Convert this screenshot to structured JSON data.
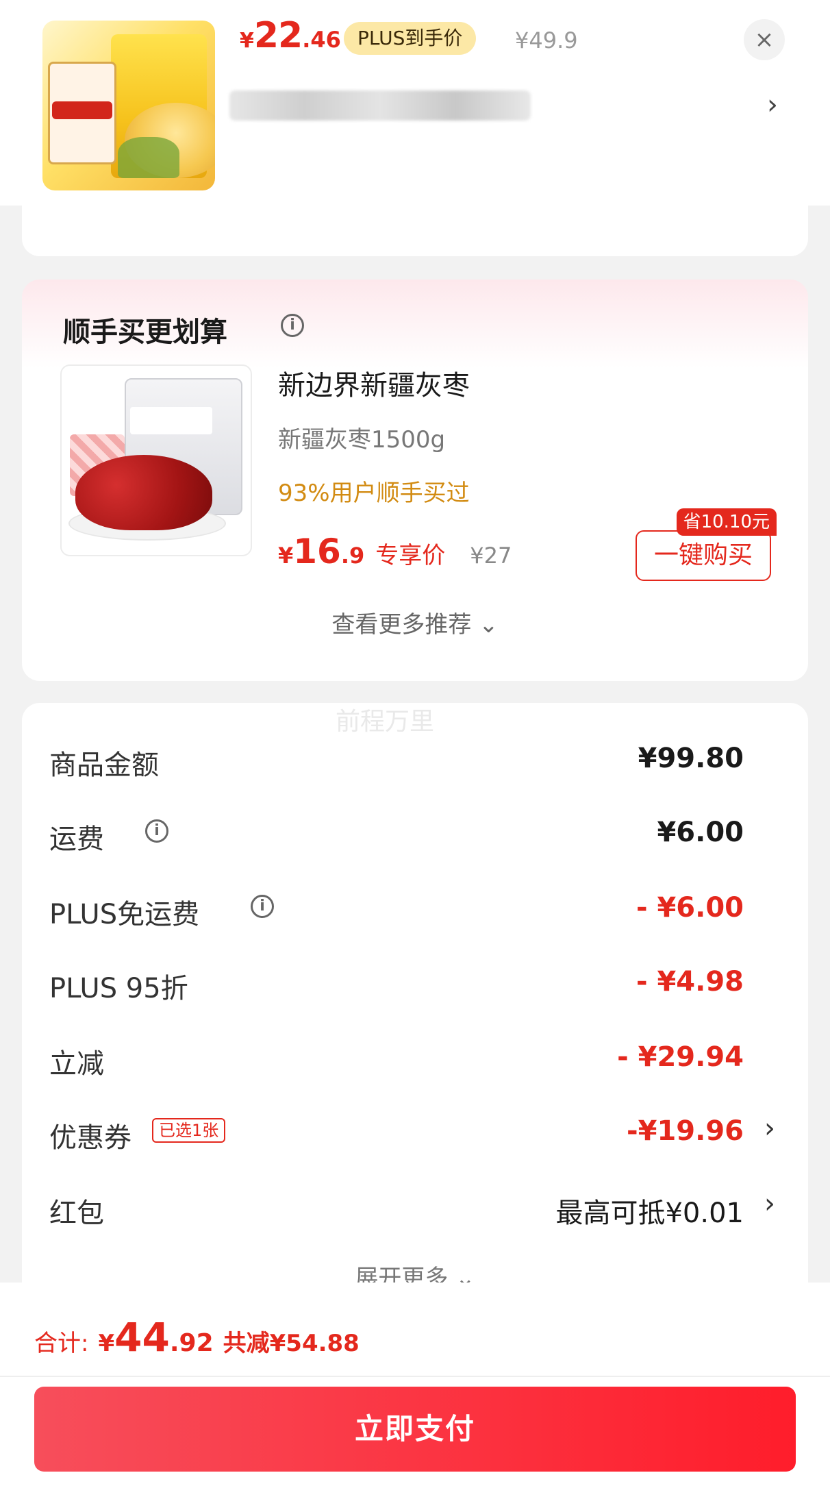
{
  "top_product": {
    "price_symbol": "¥",
    "price_int": "22",
    "price_dec": ".46",
    "plus_badge": "PLUS到手价",
    "old_price": "¥49.9",
    "close_glyph": "×",
    "chevron_glyph": "›"
  },
  "recommend": {
    "title": "顺手买更划算",
    "info_glyph": "i",
    "product_name": "新边界新疆灰枣",
    "spec": "新疆灰枣1500g",
    "social_proof": "93%用户顺手买过",
    "price_symbol": "¥",
    "price_int": "16",
    "price_dec": ".9",
    "price_label": "专享价",
    "old_price": "¥27",
    "save_badge": "省10.10元",
    "buy_button": "一键购买",
    "more_link": "查看更多推荐 ⌄"
  },
  "watermark": "前程万里",
  "fees": {
    "goods_label": "商品金额",
    "goods_value": "¥99.80",
    "shipping_label": "运费",
    "shipping_value": "¥6.00",
    "plus_free_label": "PLUS免运费",
    "plus_free_value": "- ¥6.00",
    "plus_discount_label": "PLUS 95折",
    "plus_discount_value": "- ¥4.98",
    "instant_label": "立减",
    "instant_value": "- ¥29.94",
    "coupon_label": "优惠券",
    "coupon_tag": "已选1张",
    "coupon_value": "-¥19.96",
    "redpacket_label": "红包",
    "redpacket_value": "最高可抵¥0.01",
    "expand_more": "展开更多 ⌄",
    "chevron_glyph": "›",
    "info_glyph": "i"
  },
  "bottom": {
    "total_label": "合计:",
    "total_symbol": "¥",
    "total_int": "44",
    "total_dec": ".92",
    "total_saved": "共减¥54.88",
    "pay_button": "立即支付"
  },
  "colors": {
    "accent_red": "#e4281d",
    "plus_gold": "#fce8a6",
    "social_orange": "#d28b12"
  }
}
